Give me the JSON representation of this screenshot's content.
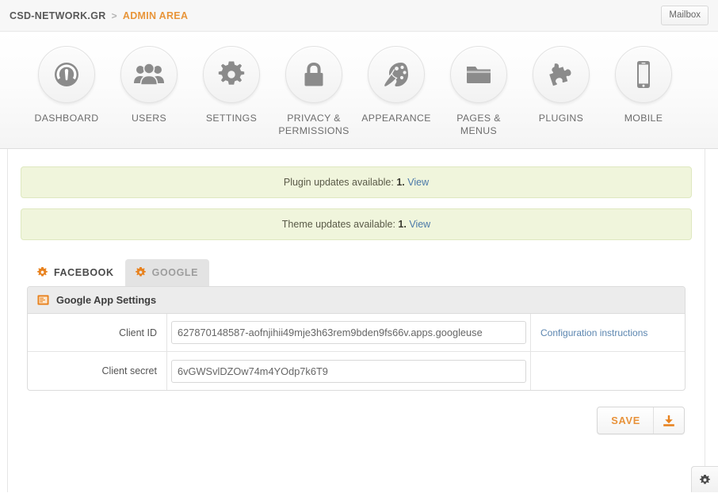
{
  "topbar": {
    "site": "CSD-NETWORK.GR",
    "separator": ">",
    "current": "ADMIN AREA",
    "mailbox_label": "Mailbox"
  },
  "nav": {
    "items": [
      {
        "label": "DASHBOARD",
        "icon": "dashboard-gauge-icon"
      },
      {
        "label": "USERS",
        "icon": "users-group-icon"
      },
      {
        "label": "SETTINGS",
        "icon": "gear-icon"
      },
      {
        "label": "PRIVACY &\nPERMISSIONS",
        "label_line1": "PRIVACY &",
        "label_line2": "PERMISSIONS",
        "icon": "padlock-icon"
      },
      {
        "label": "APPEARANCE",
        "icon": "palette-brush-icon"
      },
      {
        "label": "PAGES & MENUS",
        "icon": "folder-icon"
      },
      {
        "label": "PLUGINS",
        "icon": "puzzle-piece-icon"
      },
      {
        "label": "MOBILE",
        "icon": "smartphone-icon"
      }
    ]
  },
  "notices": [
    {
      "text": "Plugin updates available:",
      "count": "1.",
      "link": "View"
    },
    {
      "text": "Theme updates available:",
      "count": "1.",
      "link": "View"
    }
  ],
  "tabs": [
    {
      "label": "FACEBOOK",
      "icon": "gear-icon",
      "active": false
    },
    {
      "label": "GOOGLE",
      "icon": "gear-icon",
      "active": true
    }
  ],
  "panel": {
    "title": "Google App Settings",
    "icon": "window-panel-icon",
    "rows": [
      {
        "label": "Client ID",
        "value": "627870148587-aofnjihii49mje3h63rem9bden9fs66v.apps.googleuse",
        "placeholder": "",
        "aux_link": "Configuration instructions"
      },
      {
        "label": "Client secret",
        "value": "6vGWSvlDZOw74m4YOdp7k6T9",
        "placeholder": "",
        "aux_link": ""
      }
    ]
  },
  "save": {
    "label": "SAVE",
    "icon": "save-download-icon"
  },
  "footer": {
    "gear_icon": "gear-icon"
  },
  "colors": {
    "accent_orange": "#e8953a",
    "notice_bg": "#f0f5dc",
    "notice_border": "#dfe8c0",
    "link_blue": "#4a78a8",
    "tab_active_bg": "#e3e3e3",
    "icon_gray": "#8b8b8b"
  }
}
